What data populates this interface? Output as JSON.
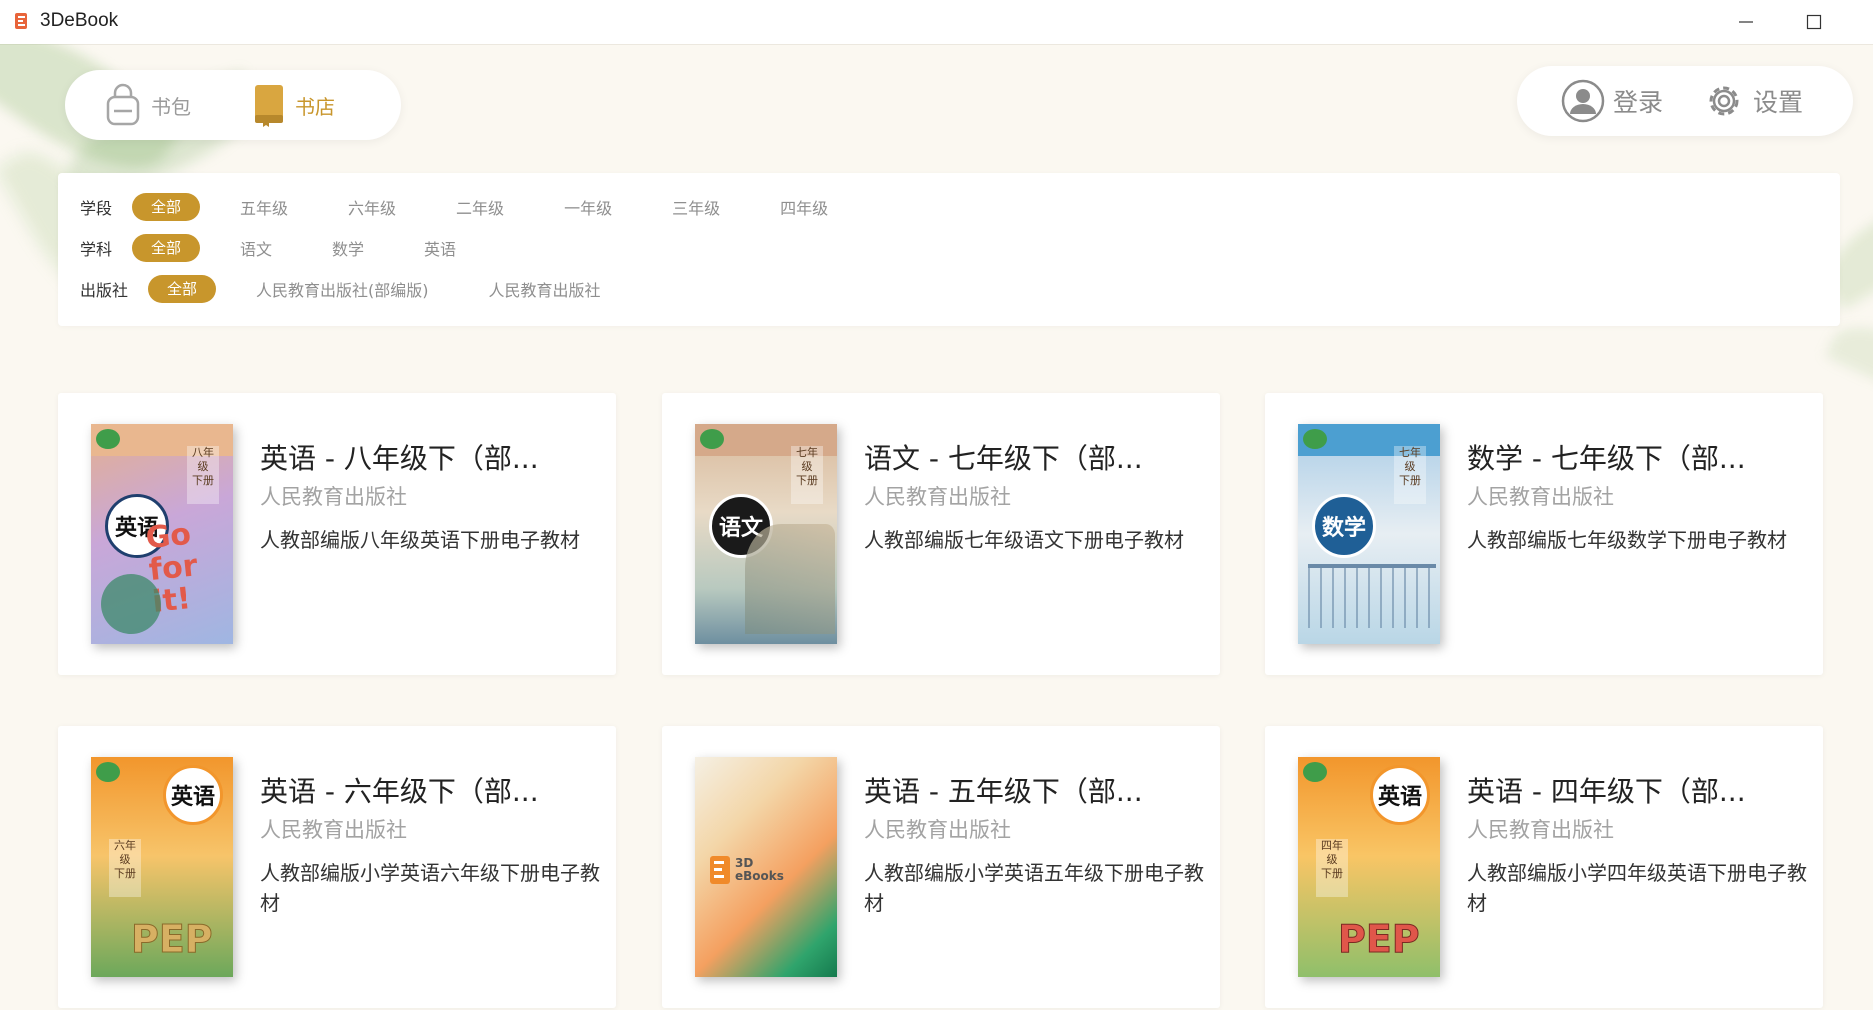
{
  "window": {
    "title": "3DeBook"
  },
  "nav": {
    "bag_label": "书包",
    "store_label": "书店"
  },
  "user": {
    "login_label": "登录",
    "settings_label": "设置"
  },
  "filters": {
    "stage": {
      "label": "学段",
      "active": "全部",
      "options": [
        "五年级",
        "六年级",
        "二年级",
        "一年级",
        "三年级",
        "四年级"
      ]
    },
    "subject": {
      "label": "学科",
      "active": "全部",
      "options": [
        "语文",
        "数学",
        "英语"
      ]
    },
    "publisher": {
      "label": "出版社",
      "active": "全部",
      "options": [
        "人民教育出版社(部编版)",
        "人民教育出版社"
      ]
    }
  },
  "books": [
    {
      "title": "英语 - 八年级下（部...",
      "publisher": "人民教育出版社",
      "desc": "人教部编版八年级英语下册电子教材",
      "cover": {
        "subject": "英语",
        "grade": "八年级",
        "volume": "下册",
        "art": "Go for it!"
      }
    },
    {
      "title": "语文 - 七年级下（部...",
      "publisher": "人民教育出版社",
      "desc": "人教部编版七年级语文下册电子教材",
      "cover": {
        "subject": "语文",
        "grade": "七年级",
        "volume": "下册"
      }
    },
    {
      "title": "数学 - 七年级下（部...",
      "publisher": "人民教育出版社",
      "desc": "人教部编版七年级数学下册电子教材",
      "cover": {
        "subject": "数学",
        "grade": "七年级",
        "volume": "下册"
      }
    },
    {
      "title": "英语 - 六年级下（部...",
      "publisher": "人民教育出版社",
      "desc": "人教部编版小学英语六年级下册电子教材",
      "cover": {
        "subject": "英语",
        "grade": "六年级",
        "volume": "下册",
        "art": "PEP"
      }
    },
    {
      "title": "英语 - 五年级下（部...",
      "publisher": "人民教育出版社",
      "desc": "人教部编版小学英语五年级下册电子教材",
      "cover": {
        "logo_text": "3D eBooks"
      }
    },
    {
      "title": "英语 - 四年级下（部...",
      "publisher": "人民教育出版社",
      "desc": "人教部编版小学四年级英语下册电子教材",
      "cover": {
        "subject": "英语",
        "grade": "四年级",
        "volume": "下册",
        "art": "PEP"
      }
    }
  ],
  "colors": {
    "accent": "#c8962c",
    "background": "#fbf8f1"
  }
}
